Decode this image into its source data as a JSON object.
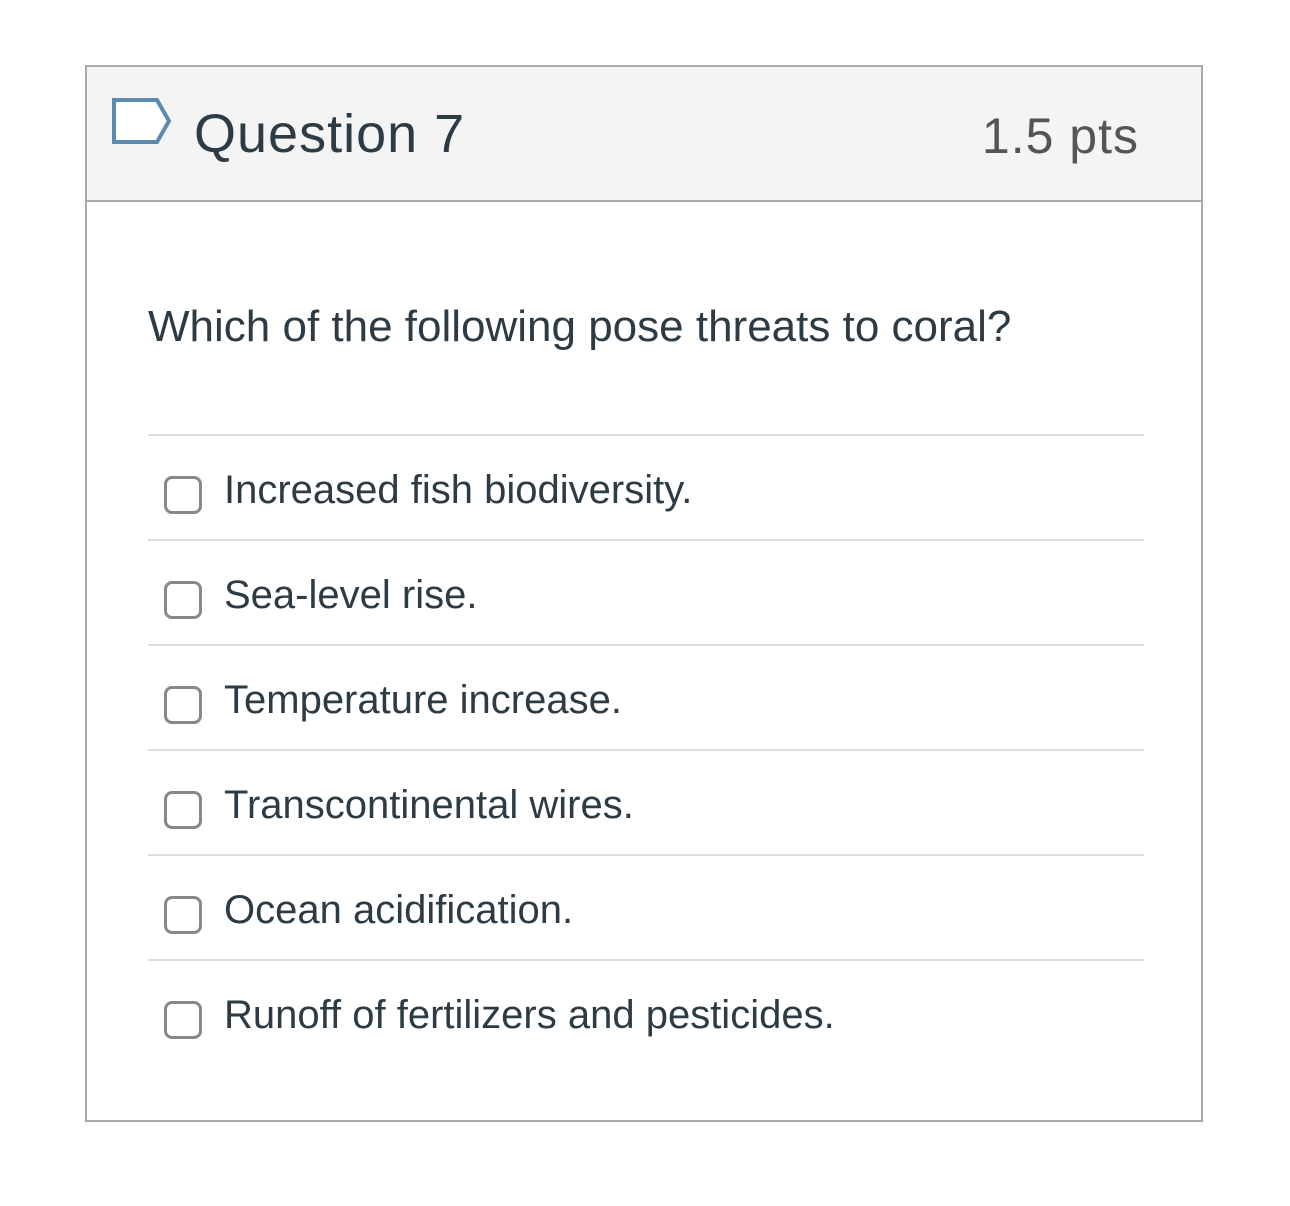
{
  "question": {
    "title": "Question 7",
    "points": "1.5 pts",
    "flag_icon": "flag-outline-icon",
    "text": "Which of the following pose threats to coral?",
    "answers": [
      {
        "label": "Increased fish biodiversity.",
        "checked": false
      },
      {
        "label": "Sea-level rise.",
        "checked": false
      },
      {
        "label": "Temperature increase.",
        "checked": false
      },
      {
        "label": "Transcontinental wires.",
        "checked": false
      },
      {
        "label": "Ocean acidification.",
        "checked": false
      },
      {
        "label": "Runoff of fertilizers and pesticides.",
        "checked": false
      }
    ]
  },
  "colors": {
    "header_bg": "#f4f4f4",
    "border": "#a9a9a9",
    "text": "#2d3b45",
    "flag": "#5b8bb0"
  }
}
